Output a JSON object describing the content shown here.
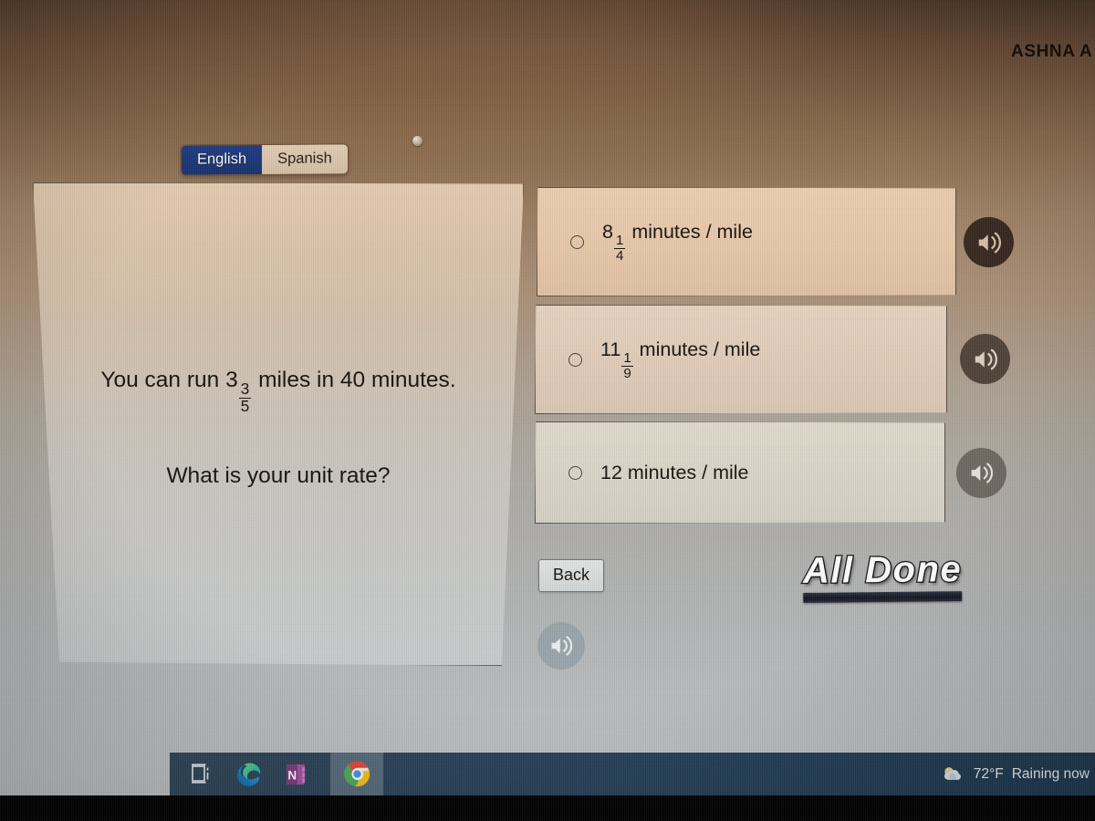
{
  "header": {
    "student_name": "ASHNA A"
  },
  "language_toggle": {
    "english_label": "English",
    "spanish_label": "Spanish",
    "active": "English"
  },
  "question": {
    "line1_prefix": "You can run 3",
    "line1_fraction": {
      "numerator": "3",
      "denominator": "5"
    },
    "line1_suffix": " miles in 40 minutes.",
    "line2": "What is your unit rate?",
    "audio_icon": "speaker-icon"
  },
  "answers": [
    {
      "whole": "8",
      "fraction": {
        "numerator": "1",
        "denominator": "4"
      },
      "unit": " minutes / mile",
      "selected": false,
      "audio_icon": "speaker-icon"
    },
    {
      "whole": "11",
      "fraction": {
        "numerator": "1",
        "denominator": "9"
      },
      "unit": " minutes / mile",
      "selected": false,
      "audio_icon": "speaker-icon"
    },
    {
      "whole": "12",
      "fraction": null,
      "unit": " minutes / mile",
      "selected": false,
      "audio_icon": "speaker-icon"
    }
  ],
  "controls": {
    "back_label": "Back",
    "all_done_label": "All Done"
  },
  "taskbar": {
    "icons": [
      {
        "name": "task-view-icon",
        "title": "Task View"
      },
      {
        "name": "edge-icon",
        "title": "Microsoft Edge"
      },
      {
        "name": "onenote-icon",
        "title": "OneNote",
        "glyph": "N"
      },
      {
        "name": "chrome-icon",
        "title": "Google Chrome"
      }
    ],
    "weather": {
      "icon": "cloud-icon",
      "temperature": "72°F",
      "condition": "Raining now"
    }
  },
  "colors": {
    "accent_blue": "#1d3a80",
    "taskbar_blue": "#26405a",
    "choice_1_bg": "#e9c9aa",
    "choice_2_bg": "#e2cdb9",
    "choice_3_bg": "#dcd6c9",
    "text_dark": "#15110d"
  }
}
